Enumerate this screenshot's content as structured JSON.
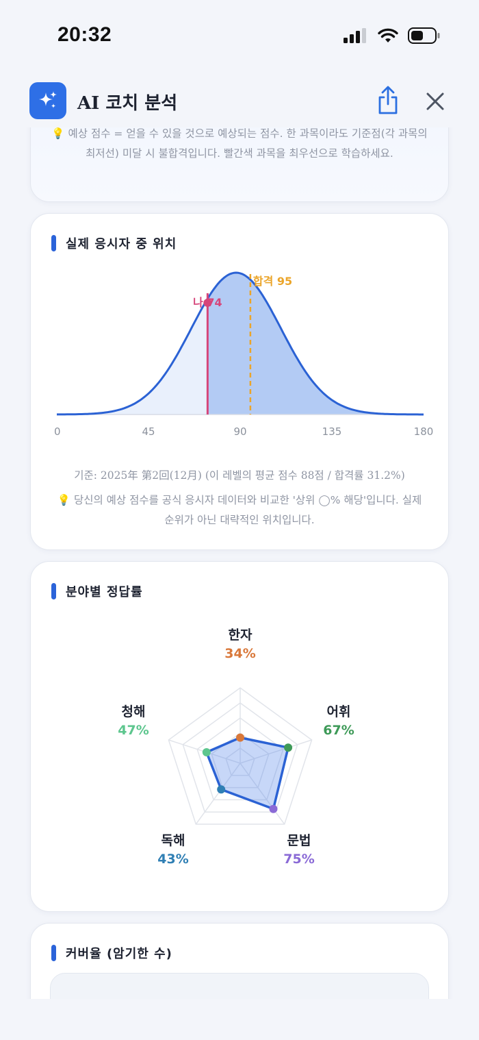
{
  "status": {
    "time": "20:32"
  },
  "header": {
    "title": "AI 코치 분석"
  },
  "top_card": {
    "note": "💡 예상 점수 = 얻을 수 있을 것으로 예상되는 점수. 한 과목이라도 기준점(각 과목의 최저선) 미달 시 불합격입니다. 빨간색 과목을 최우선으로 학습하세요."
  },
  "distribution": {
    "title": "실제 응시자 중 위치",
    "my_label": "나 74",
    "pass_label": "합격 95",
    "basis": "기준: 2025年 第2回(12月) (이 레벨의 평균 점수 88점 / 합격률 31.2%)",
    "note": "💡 당신의 예상 점수를 공식 응시자 데이터와 비교한 '상위 ◯% 해당'입니다. 실제 순위가 아닌 대략적인 위치입니다.",
    "colors": {
      "curve": "#2b62d4",
      "fill_light": "#e9f0fc",
      "fill_dark": "#b3cbf4",
      "me": "#d6457a",
      "pass": "#eba52a"
    }
  },
  "chart_data": [
    {
      "type": "area",
      "title": "실제 응시자 중 위치",
      "x_ticks": [
        0,
        45,
        90,
        135,
        180
      ],
      "xlim": [
        0,
        180
      ],
      "peak_x": 88,
      "spread": 22,
      "markers": [
        {
          "label": "나 74",
          "x": 74
        },
        {
          "label": "합격 95",
          "x": 95
        }
      ]
    },
    {
      "type": "radar",
      "title": "분야별 정답률",
      "categories": [
        "한자",
        "어휘",
        "문법",
        "독해",
        "청해"
      ],
      "values": [
        34,
        67,
        75,
        43,
        47
      ],
      "max": 100,
      "colors": [
        "#d9783a",
        "#3e9a58",
        "#8a6ad6",
        "#2f7fb4",
        "#5dc68e"
      ]
    }
  ],
  "radar": {
    "title": "분야별 정답률",
    "value_labels": [
      "34%",
      "67%",
      "75%",
      "43%",
      "47%"
    ]
  },
  "coverage": {
    "title": "커버율 (암기한 수)"
  }
}
